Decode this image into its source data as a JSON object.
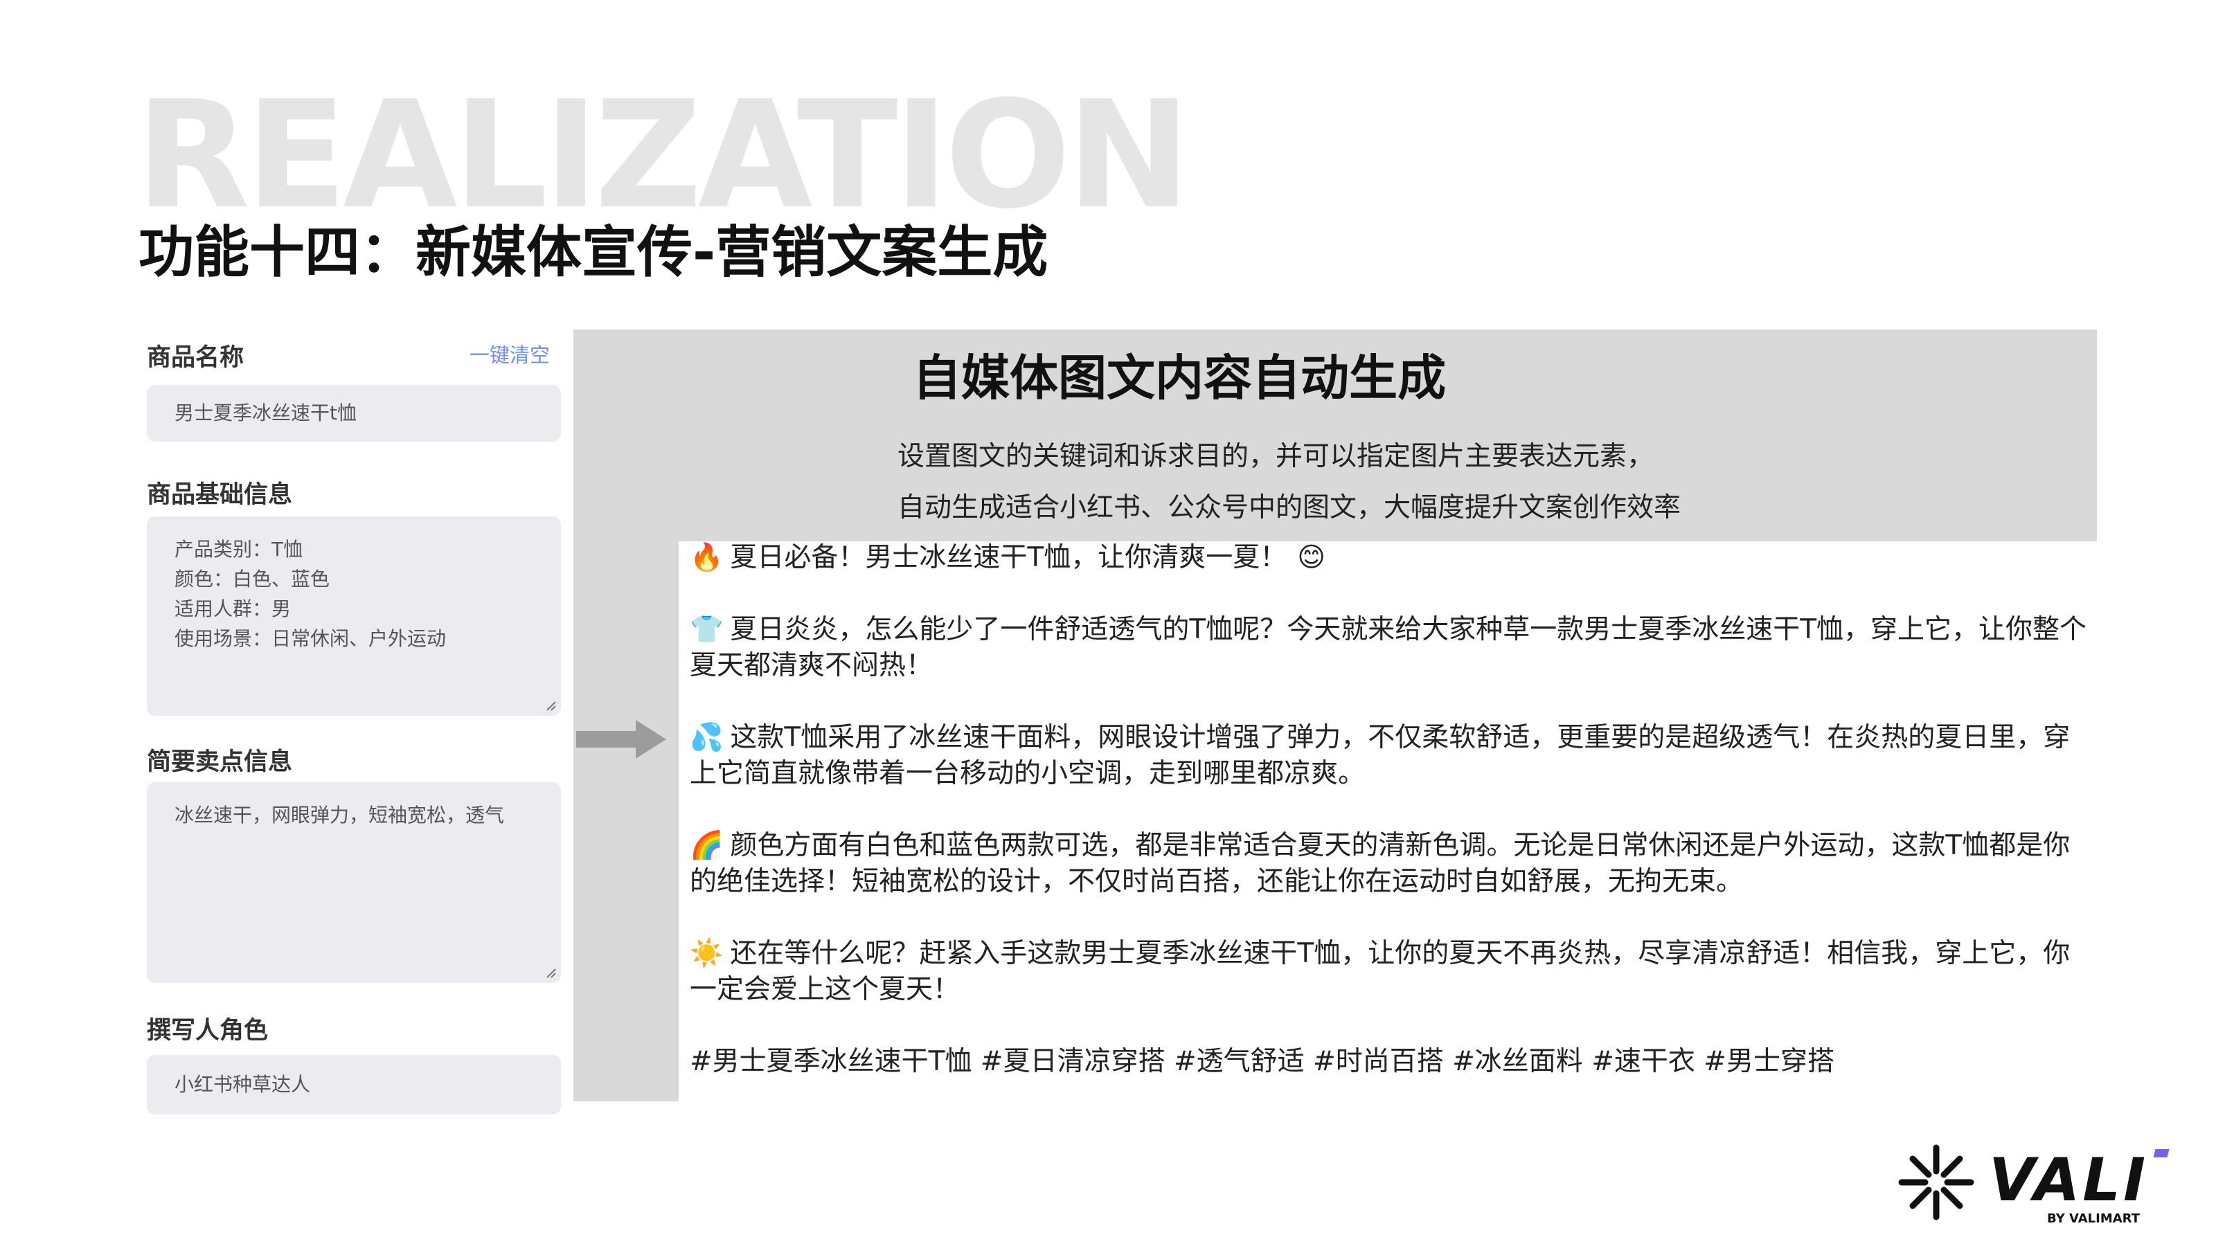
{
  "watermark": "REALIZATION",
  "title": "功能十四：新媒体宣传-营销文案生成",
  "form": {
    "product_name_label": "商品名称",
    "clear_label": "一键清空",
    "product_name_value": "男士夏季冰丝速干t恤",
    "basic_info_label": "商品基础信息",
    "basic_info_lines": [
      "产品类别：T恤",
      "颜色：白色、蓝色",
      "适用人群：男",
      "使用场景：日常休闲、户外运动"
    ],
    "selling_points_label": "简要卖点信息",
    "selling_points_value": "冰丝速干，网眼弹力，短袖宽松，透气",
    "writer_role_label": "撰写人角色",
    "writer_role_value": "小红书种草达人"
  },
  "panel": {
    "title": "自媒体图文内容自动生成",
    "desc_line1": "设置图文的关键词和诉求目的，并可以指定图片主要表达元素，",
    "desc_line2": "自动生成适合小红书、公众号中的图文，大幅度提升文案创作效率"
  },
  "generated": {
    "p1_emoji": "🔥",
    "p1": "夏日必备！男士冰丝速干T恤，让你清爽一夏！",
    "p1_end_emoji": "😊",
    "p2_emoji": "👕",
    "p2": "夏日炎炎，怎么能少了一件舒适透气的T恤呢？今天就来给大家种草一款男士夏季冰丝速干T恤，穿上它，让你整个夏天都清爽不闷热！",
    "p3_emoji": "💦",
    "p3": "这款T恤采用了冰丝速干面料，网眼设计增强了弹力，不仅柔软舒适，更重要的是超级透气！在炎热的夏日里，穿上它简直就像带着一台移动的小空调，走到哪里都凉爽。",
    "p4_emoji": "🌈",
    "p4": "颜色方面有白色和蓝色两款可选，都是非常适合夏天的清新色调。无论是日常休闲还是户外运动，这款T恤都是你的绝佳选择！短袖宽松的设计，不仅时尚百搭，还能让你在运动时自如舒展，无拘无束。",
    "p5_emoji": "☀️",
    "p5": "还在等什么呢？赶紧入手这款男士夏季冰丝速干T恤，让你的夏天不再炎热，尽享清凉舒适！相信我，穿上它，你一定会爱上这个夏天！",
    "hashtags": "#男士夏季冰丝速干T恤 #夏日清凉穿搭 #透气舒适 #时尚百搭 #冰丝面料 #速干衣 #男士穿搭"
  },
  "logo": {
    "brand": "VALI",
    "sub": "BY VALIMART"
  },
  "colors": {
    "accent": "#6f8ff2",
    "panel_gray": "#d9d9d9",
    "field_bg": "#ebebf0",
    "logo_purple": "#7b5cf0"
  }
}
